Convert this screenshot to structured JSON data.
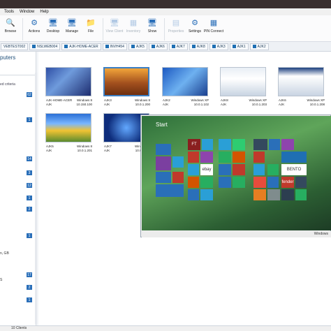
{
  "menubar": [
    "Tools",
    "Window",
    "Help"
  ],
  "ribbon": [
    {
      "label": "Browse",
      "icon": "search-icon",
      "disabled": false
    },
    {
      "label": "Actions",
      "icon": "actions-icon",
      "disabled": false
    },
    {
      "label": "Desktop",
      "icon": "desktop-icon",
      "disabled": false
    },
    {
      "label": "Manage",
      "icon": "manage-icon",
      "disabled": false
    },
    {
      "label": "File",
      "icon": "folder-icon",
      "disabled": false
    },
    {
      "label": "View Client",
      "icon": "view-client-icon",
      "disabled": true
    },
    {
      "label": "Inventory",
      "icon": "inventory-icon",
      "disabled": true
    },
    {
      "label": "Show",
      "icon": "show-icon",
      "disabled": false
    },
    {
      "label": "Properties",
      "icon": "properties-icon",
      "disabled": true
    },
    {
      "label": "Settings",
      "icon": "gear-icon",
      "disabled": false
    },
    {
      "label": "PIN Connect",
      "icon": "pin-connect-icon",
      "disabled": false
    }
  ],
  "tabs": [
    "VEBTEST002",
    "NSLWEB004",
    "AJK-HOME-ACER",
    "INVH454",
    "AJK5",
    "AJK6",
    "AJK7",
    "AJK8",
    "AJK3",
    "AJK1",
    "AJK2"
  ],
  "left_panel": {
    "title": "puters",
    "subtitle": "ed criteria",
    "counts": [
      "62",
      "1",
      "14",
      "3",
      "12",
      "1",
      "2",
      "1",
      "17",
      "2",
      "1"
    ],
    "fragments": [
      "n, GB",
      "S"
    ]
  },
  "status_bar": "10 Clients",
  "clients": [
    {
      "name": "AJK-HOME-ACER",
      "user": "AJK",
      "os": "Windows 8",
      "ip": "10.150.100",
      "selected": false
    },
    {
      "name": "AJK3",
      "user": "AJK",
      "os": "Windows 8",
      "ip": "10.0.1.200",
      "selected": true
    },
    {
      "name": "AJK2",
      "user": "AJK",
      "os": "Windows XP",
      "ip": "10.0.1.102",
      "selected": false
    },
    {
      "name": "AJK8",
      "user": "AJK",
      "os": "Windows XP",
      "ip": "10.0.1.203",
      "selected": false
    },
    {
      "name": "AJK6",
      "user": "AJK",
      "os": "Windows XP",
      "ip": "10.0.1.208",
      "selected": false
    },
    {
      "name": "AJK5",
      "user": "AJK",
      "os": "Windows 8",
      "ip": "10.0.1.201",
      "selected": false
    },
    {
      "name": "AJK7",
      "user": "AJK",
      "os": "Windows 8",
      "ip": "10.0.1.205",
      "selected": false
    }
  ],
  "floating_window": {
    "start_label": "Start",
    "footer": "Windows"
  },
  "tile_texts": {
    "ft": "FT",
    "ebay": "ebay",
    "bento": "BENTO",
    "fender": "fender"
  }
}
